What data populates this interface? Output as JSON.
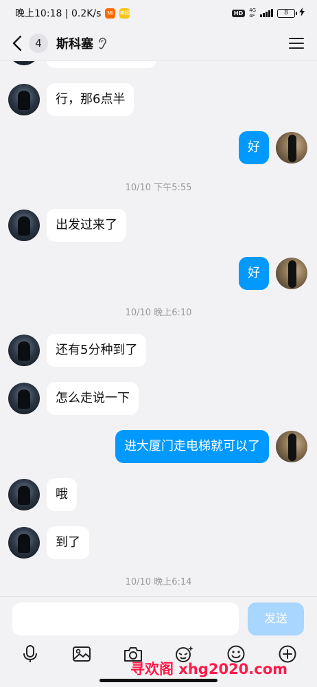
{
  "status_bar": {
    "time_speed": "晚上10:18 | 0.2K/s",
    "mi_label": "Mi",
    "ms_label": "美团",
    "hd": "HD",
    "net_top": "4G",
    "net_bottom": "4F",
    "battery": "8"
  },
  "header": {
    "unread_count": "4",
    "title": "斯科塞"
  },
  "messages": [
    {
      "side": "left",
      "text": "行，那6点半"
    },
    {
      "side": "right",
      "text": "好"
    },
    {
      "timestamp": "10/10 下午5:55"
    },
    {
      "side": "left",
      "text": "出发过来了"
    },
    {
      "side": "right",
      "text": "好"
    },
    {
      "timestamp": "10/10 晚上6:10"
    },
    {
      "side": "left",
      "text": "还有5分种到了"
    },
    {
      "side": "left",
      "text": "怎么走说一下"
    },
    {
      "side": "right",
      "text": "进大厦门走电梯就可以了"
    },
    {
      "side": "left",
      "text": "哦"
    },
    {
      "side": "left",
      "text": "到了"
    },
    {
      "timestamp": "10/10 晚上6:14"
    }
  ],
  "input": {
    "placeholder": "",
    "send_label": "发送"
  },
  "toolbar": {
    "icons": [
      "microphone-icon",
      "image-icon",
      "camera-icon",
      "sticker-icon",
      "emoji-icon",
      "plus-icon"
    ]
  },
  "watermark": "寻欢阁 xhg2020.com",
  "colors": {
    "accent": "#0099ff",
    "send_disabled": "#a8d6ff",
    "background": "#f2f2f4"
  }
}
